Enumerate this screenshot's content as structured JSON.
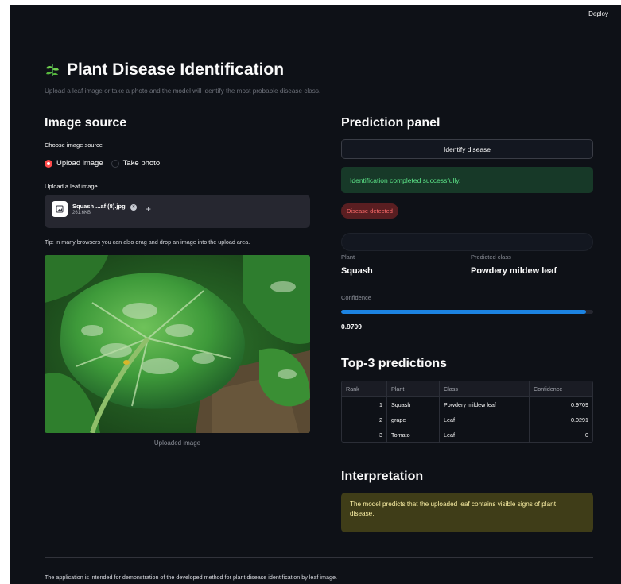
{
  "header": {
    "deploy_label": "Deploy"
  },
  "page": {
    "title": "Plant Disease Identification",
    "subtitle": "Upload a leaf image or take a photo and the model will identify the most probable disease class."
  },
  "left": {
    "heading": "Image source",
    "choose_label": "Choose image source",
    "options": [
      {
        "label": "Upload image",
        "selected": true
      },
      {
        "label": "Take photo",
        "selected": false
      }
    ],
    "upload_label": "Upload a leaf image",
    "file": {
      "name": "Squash ...af (8).jpg",
      "size": "261.6KB"
    },
    "tip": "Tip: in many browsers you can also drag and drop an image into the upload area.",
    "image_caption": "Uploaded image"
  },
  "right": {
    "heading": "Prediction panel",
    "identify_button": "Identify disease",
    "success_message": "Identification completed successfully.",
    "badge": "Disease detected",
    "plant_label": "Plant",
    "plant_value": "Squash",
    "class_label": "Predicted class",
    "class_value": "Powdery mildew leaf",
    "confidence_label": "Confidence",
    "confidence_value": "0.9709",
    "confidence_fraction": 0.9709,
    "top3_heading": "Top-3 predictions",
    "table": {
      "columns": [
        "Rank",
        "Plant",
        "Class",
        "Confidence"
      ],
      "rows": [
        [
          "1",
          "Squash",
          "Powdery mildew leaf",
          "0.9709"
        ],
        [
          "2",
          "grape",
          "Leaf",
          "0.0291"
        ],
        [
          "3",
          "Tomato",
          "Leaf",
          "0"
        ]
      ]
    },
    "interpretation_heading": "Interpretation",
    "interpretation_text": "The model predicts that the uploaded leaf contains visible signs of plant disease."
  },
  "footer": {
    "text": "The application is intended for demonstration of the developed method for plant disease identification by leaf image."
  },
  "colors": {
    "background": "#0e1117",
    "accent_red": "#ff4b4b",
    "progress_blue": "#1c83e1",
    "success_green": "#5ce488",
    "warning_yellow": "#fbf0a5"
  }
}
